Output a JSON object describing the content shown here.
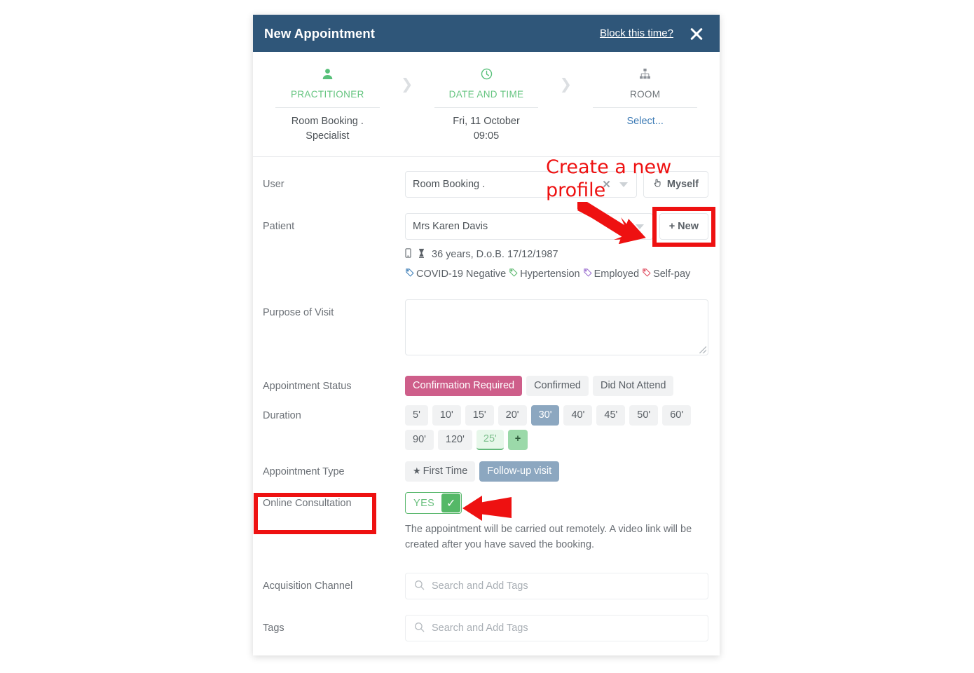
{
  "header": {
    "title": "New Appointment",
    "block_link": "Block this time?",
    "close_icon": "close-icon"
  },
  "stepper": {
    "steps": [
      {
        "icon": "user-icon",
        "label": "PRACTITIONER",
        "value": "Room Booking .\nSpecialist",
        "value_line1": "Room Booking .",
        "value_line2": "Specialist",
        "state": "active"
      },
      {
        "icon": "clock-icon",
        "label": "DATE AND TIME",
        "value_line1": "Fri, 11 October",
        "value_line2": "09:05",
        "state": "active"
      },
      {
        "icon": "sitemap-icon",
        "label": "ROOM",
        "value_line1": "Select...",
        "value_line2": "",
        "state": "inactive"
      }
    ],
    "arrow": "chevron-right-icon"
  },
  "form": {
    "user": {
      "label": "User",
      "value": "Room Booking .",
      "clear_icon": "clear-icon",
      "caret_icon": "chevron-down-icon",
      "myself_button": "Myself",
      "myself_icon": "hand-pointer-icon"
    },
    "patient": {
      "label": "Patient",
      "value": "Mrs Karen Davis",
      "caret_icon": "chevron-down-icon",
      "new_button": "+ New",
      "meta": {
        "mobile_icon": "mobile-phone-icon",
        "age_icon": "hourglass-icon",
        "age_text": "36 years, D.o.B. 17/12/1987"
      },
      "tags": [
        {
          "label": "COVID-19 Negative",
          "color": "#3f7fb8"
        },
        {
          "label": "Hypertension",
          "color": "#5cb96f"
        },
        {
          "label": "Employed",
          "color": "#9b6fd0"
        },
        {
          "label": "Self-pay",
          "color": "#e04b5f"
        }
      ]
    },
    "purpose": {
      "label": "Purpose of Visit",
      "value": "",
      "placeholder": ""
    },
    "appointment_status": {
      "label": "Appointment Status",
      "options": [
        "Confirmation Required",
        "Confirmed",
        "Did Not Attend"
      ],
      "selected": "Confirmation Required"
    },
    "duration": {
      "label": "Duration",
      "options": [
        "5'",
        "10'",
        "15'",
        "20'",
        "30'",
        "40'",
        "45'",
        "50'",
        "60'",
        "90'",
        "120'"
      ],
      "selected": "30'",
      "custom_value": "25'",
      "add_button": "+"
    },
    "appointment_type": {
      "label": "Appointment Type",
      "options": [
        "First Time",
        "Follow-up visit"
      ],
      "first_time_star": "★",
      "selected": "Follow-up visit"
    },
    "online_consultation": {
      "label": "Online Consultation",
      "toggle_label": "YES",
      "toggle_checked": true,
      "check_icon": "check-icon",
      "note": "The appointment will be carried out remotely. A video link will be created after you have saved the booking."
    },
    "acquisition_channel": {
      "label": "Acquisition Channel",
      "placeholder": "Search and Add Tags",
      "search_icon": "search-icon",
      "value": ""
    },
    "tags_field": {
      "label": "Tags",
      "placeholder": "Search and Add Tags",
      "search_icon": "search-icon",
      "value": ""
    }
  },
  "annotations": {
    "callout_text": "Create a new profile",
    "color": "#ee1111",
    "arrow_to_new": "arrow-icon",
    "arrow_to_toggle": "arrow-icon",
    "box_new_label": "+ New",
    "box_online_label": "Online Consultation"
  }
}
